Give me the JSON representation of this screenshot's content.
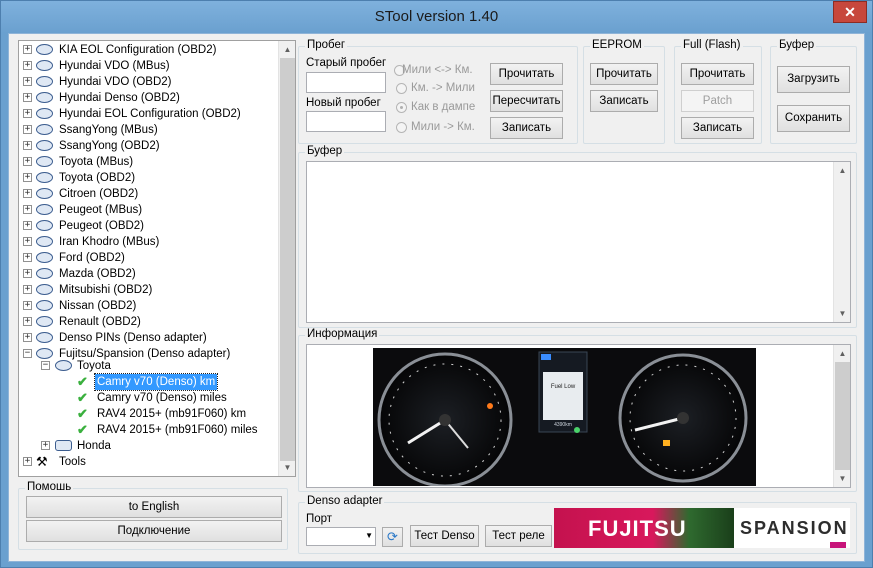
{
  "window": {
    "title": "STool version 1.40",
    "close_glyph": "✕"
  },
  "tree": {
    "items": [
      {
        "label": "KIA EOL Configuration (OBD2)",
        "icon": "kia-logo-icon"
      },
      {
        "label": "Hyundai VDO (MBus)",
        "icon": "hyundai-logo-icon"
      },
      {
        "label": "Hyundai VDO (OBD2)",
        "icon": "hyundai-logo-icon"
      },
      {
        "label": "Hyundai Denso (OBD2)",
        "icon": "hyundai-logo-icon"
      },
      {
        "label": "Hyundai EOL Configuration (OBD2)",
        "icon": "hyundai-logo-icon"
      },
      {
        "label": "SsangYong (MBus)",
        "icon": "ssangyong-logo-icon"
      },
      {
        "label": "SsangYong (OBD2)",
        "icon": "ssangyong-logo-icon"
      },
      {
        "label": "Toyota (MBus)",
        "icon": "toyota-logo-icon"
      },
      {
        "label": "Toyota (OBD2)",
        "icon": "toyota-logo-icon"
      },
      {
        "label": "Citroen (OBD2)",
        "icon": "citroen-logo-icon"
      },
      {
        "label": "Peugeot (MBus)",
        "icon": "peugeot-logo-icon"
      },
      {
        "label": "Peugeot (OBD2)",
        "icon": "peugeot-logo-icon"
      },
      {
        "label": "Iran Khodro (MBus)",
        "icon": "iran-khodro-logo-icon"
      },
      {
        "label": "Ford (OBD2)",
        "icon": "ford-logo-icon"
      },
      {
        "label": "Mazda (OBD2)",
        "icon": "mazda-logo-icon"
      },
      {
        "label": "Mitsubishi (OBD2)",
        "icon": "mitsubishi-logo-icon"
      },
      {
        "label": "Nissan (OBD2)",
        "icon": "nissan-logo-icon"
      },
      {
        "label": "Renault (OBD2)",
        "icon": "renault-logo-icon"
      },
      {
        "label": "Denso PINs (Denso adapter)",
        "icon": "denso-logo-icon"
      },
      {
        "label": "Fujitsu/Spansion (Denso adapter)",
        "icon": "fujitsu-logo-icon"
      }
    ],
    "toyota": "Toyota",
    "subitems": [
      "Camry v70 (Denso) km",
      "Camry v70 (Denso) miles",
      "RAV4 2015+ (mb91F060) km",
      "RAV4 2015+ (mb91F060) miles"
    ],
    "honda": "Honda",
    "tools": "Tools"
  },
  "help": {
    "title": "Помошь",
    "english": "to English",
    "connect": "Подключение"
  },
  "mileage": {
    "title": "Пробег",
    "old_label": "Старый пробег",
    "new_label": "Новый пробег",
    "old_value": "",
    "new_value": "",
    "options": [
      "Мили <-> Км.",
      "Км. -> Мили",
      "Как в дампе",
      "Мили -> Км."
    ],
    "read": "Прочитать",
    "recalc": "Пересчитать",
    "write": "Записать"
  },
  "eeprom": {
    "title": "EEPROM",
    "read": "Прочитать",
    "write": "Записать"
  },
  "flash": {
    "title": "Full (Flash)",
    "read": "Прочитать",
    "patch": "Patch",
    "write": "Записать"
  },
  "buffer_btns": {
    "title": "Буфер",
    "load": "Загрузить",
    "save": "Сохранить"
  },
  "buffer": {
    "title": "Буфер",
    "content": ""
  },
  "info": {
    "title": "Информация",
    "screen_title": "Fuel Low",
    "odo": "4390km"
  },
  "denso": {
    "title": "Denso adapter",
    "port_label": "Порт",
    "port_value": "",
    "test_denso": "Тест Denso",
    "test_relay": "Тест реле"
  },
  "banner": {
    "left": "FUJITSU",
    "right": "SPANSION",
    "left_color": "#d6145a",
    "right_color": "#2d2d2d"
  }
}
